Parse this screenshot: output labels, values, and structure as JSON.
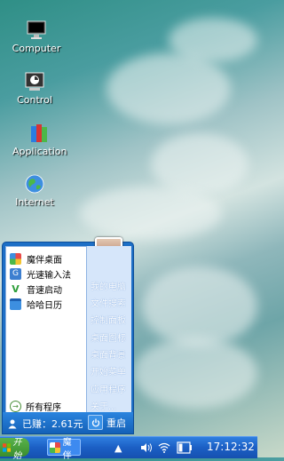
{
  "desktop": {
    "icons": [
      {
        "label": "Computer",
        "icon": "monitor-icon"
      },
      {
        "label": "Control",
        "icon": "control-panel-icon"
      },
      {
        "label": "Application",
        "icon": "books-icon"
      },
      {
        "label": "Internet",
        "icon": "globe-icon"
      }
    ]
  },
  "start_menu": {
    "apps": [
      {
        "label": "魔伴桌面",
        "icon": "pinwheel-icon"
      },
      {
        "label": "光速输入法",
        "icon": "keyboard-g-icon"
      },
      {
        "label": "音速启动",
        "icon": "v-launcher-icon"
      },
      {
        "label": "哈哈日历",
        "icon": "calendar-icon"
      }
    ],
    "all_programs": "所有程序",
    "links": [
      "我的电脑",
      "文件搜索",
      "控制面板",
      "桌面图标",
      "桌面背景",
      "开始菜单",
      "应用程序",
      "关于..."
    ],
    "earned": "已赚：2.61元",
    "restart": "重启"
  },
  "taskbar": {
    "start_label": "开始",
    "app_label": "魔伴",
    "tray_icons": [
      "up-arrow-icon",
      "volume-icon",
      "wifi-icon",
      "battery-icon"
    ],
    "clock": "17:12:32"
  }
}
